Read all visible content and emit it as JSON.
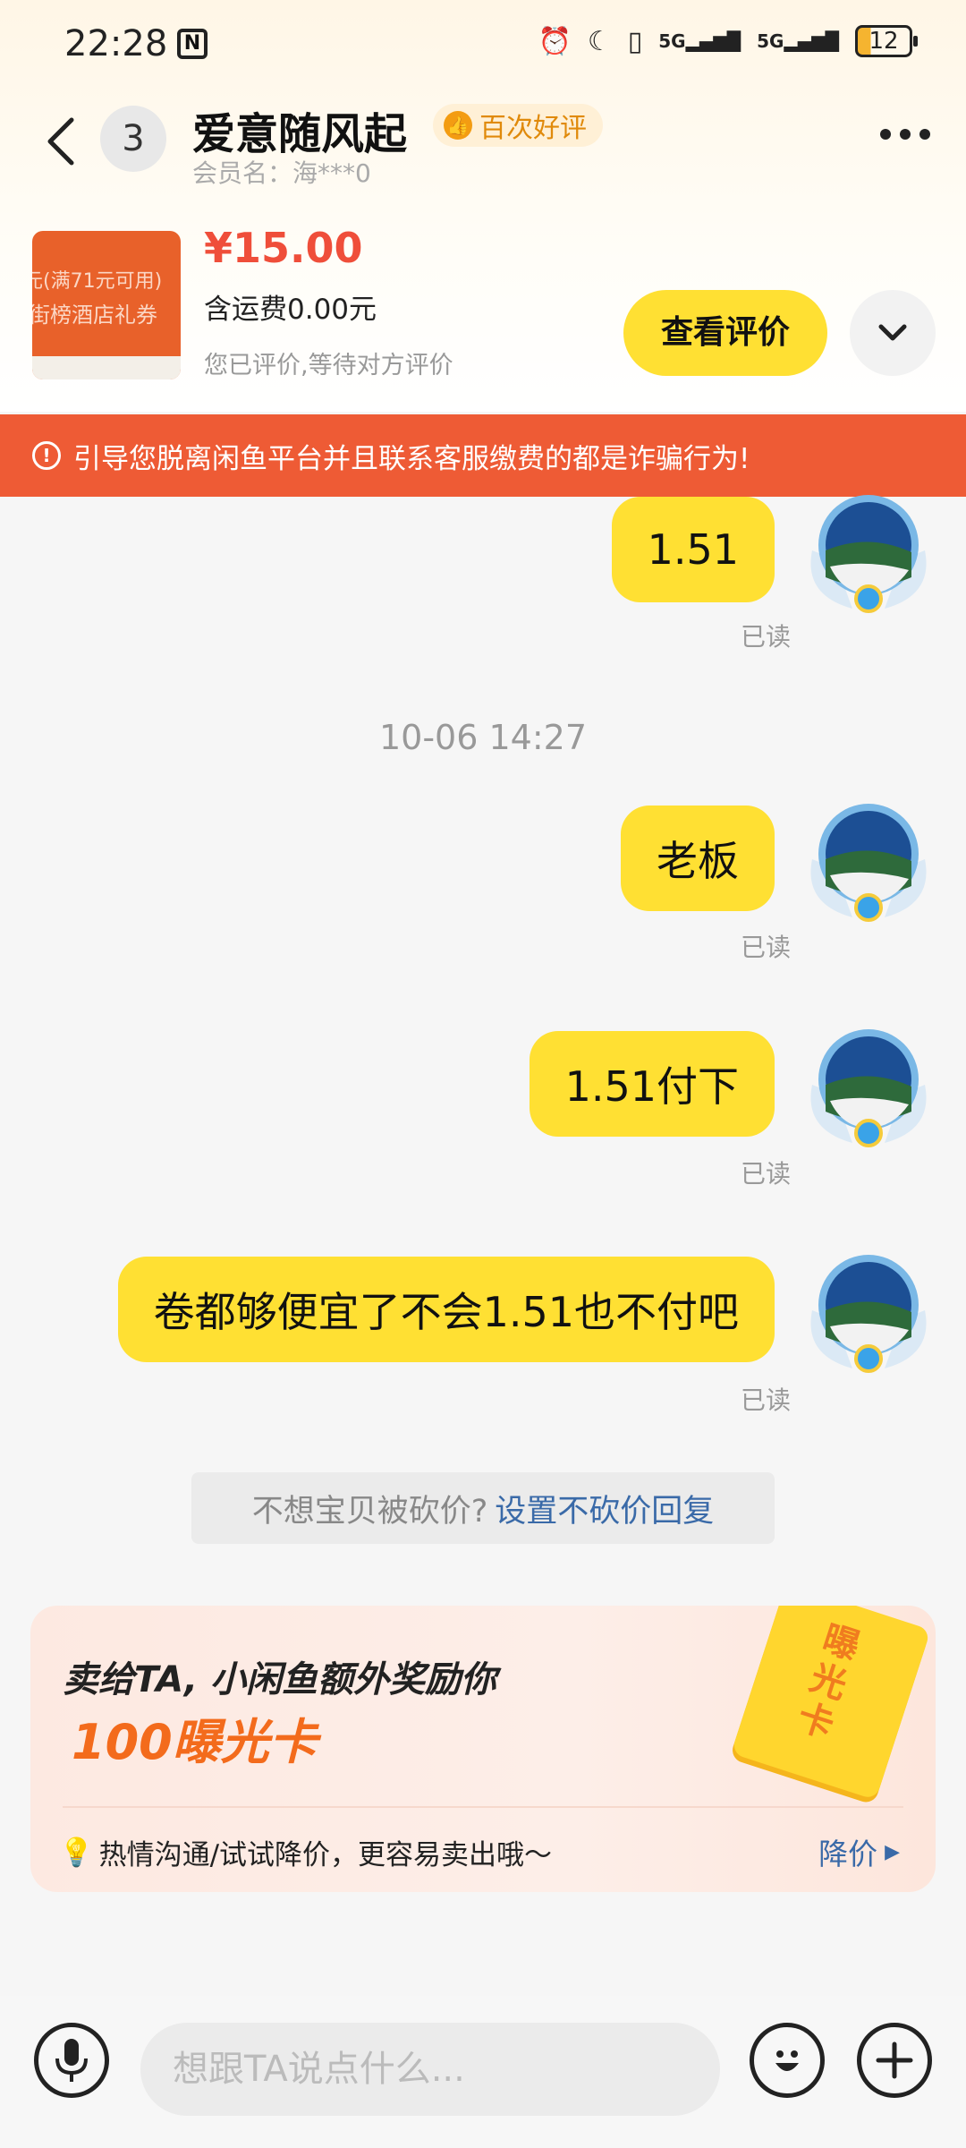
{
  "status_bar": {
    "time": "22:28",
    "signal_1": "5G",
    "signal_2": "5G",
    "battery": "12"
  },
  "header": {
    "unread_count": "3",
    "title": "爱意随风起",
    "badge": "百次好评",
    "member_label": "会员名：海***0"
  },
  "product": {
    "image_text_1": "元(满71元可用)",
    "image_text_2": "街榜酒店礼券",
    "price": "¥15.00",
    "shipping": "含运费0.00元",
    "review_status": "您已评价,等待对方评价",
    "view_review_label": "查看评价"
  },
  "warning": {
    "text": "引导您脱离闲鱼平台并且联系客服缴费的都是诈骗行为!"
  },
  "chat": {
    "timestamp": "10-06 14:27",
    "messages": [
      {
        "text": "1.51",
        "status": "已读"
      },
      {
        "text": "老板",
        "status": "已读"
      },
      {
        "text": "1.51付下",
        "status": "已读"
      },
      {
        "text": "卷都够便宜了不会1.51也不付吧",
        "status": "已读"
      }
    ]
  },
  "tip": {
    "text": "不想宝贝被砍价?",
    "link": "设置不砍价回复"
  },
  "reward": {
    "title": "卖给TA, 小闲鱼额外奖励你",
    "main": "100曝光卡",
    "ticket_text": "曝光卡",
    "hint": "热情沟通/试试降价，更容易卖出哦～",
    "action": "降价"
  },
  "input": {
    "placeholder": "想跟TA说点什么..."
  },
  "colors": {
    "accent_yellow": "#ffe033",
    "warning_red": "#ee5b35",
    "price_red": "#ef4e3a",
    "link_blue": "#3a6aa8"
  }
}
